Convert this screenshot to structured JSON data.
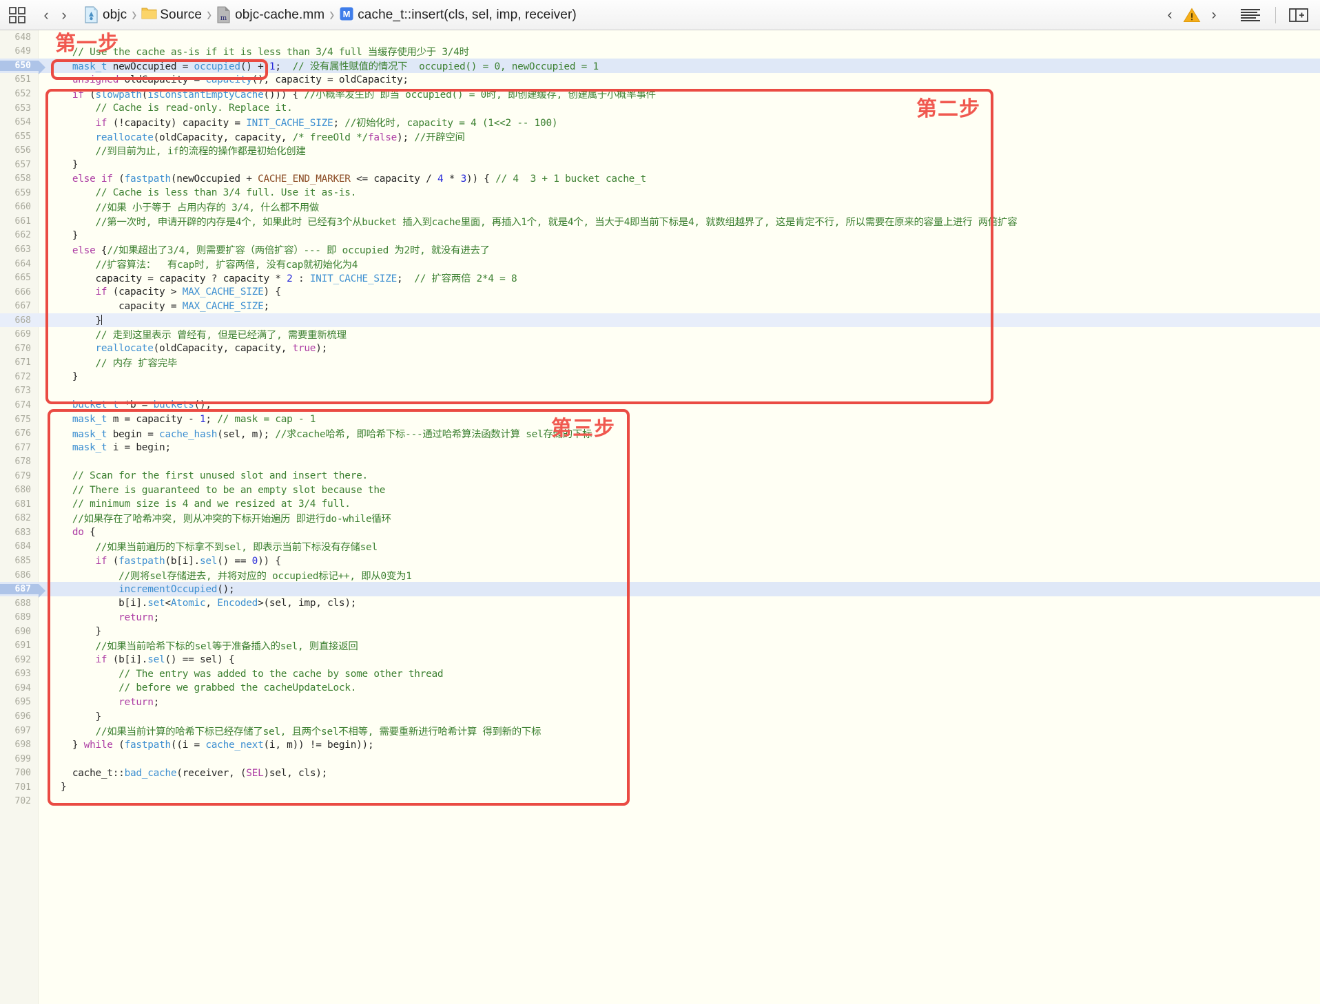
{
  "toolbar": {
    "grid_icon": "grid-icon",
    "back_label": "‹",
    "forward_label": "›",
    "breadcrumb": [
      {
        "icon": "project-icon",
        "label": "objc"
      },
      {
        "icon": "folder-icon",
        "label": "Source"
      },
      {
        "icon": "objcpp-file-icon",
        "label": "objc-cache.mm"
      },
      {
        "icon": "method-icon",
        "label": "cache_t::insert(cls, sel, imp, receiver)"
      }
    ],
    "prev_issue_label": "‹",
    "warning_icon": "warning-triangle-icon",
    "next_issue_label": "›",
    "minimap_icon": "document-lines-icon",
    "inspector_icon": "right-panel-toggle-icon"
  },
  "annotations": [
    {
      "name": "step-one-label",
      "text": "第一步"
    },
    {
      "name": "step-two-label",
      "text": "第二步"
    },
    {
      "name": "step-three-label",
      "text": "第三步"
    }
  ],
  "editor": {
    "first_line": 648,
    "highlighted_lines": [
      650,
      687
    ],
    "current_line": 668,
    "lines": [
      {
        "n": 648,
        "tokens": []
      },
      {
        "n": 649,
        "tokens": [
          {
            "t": "  ",
            "c": "plain"
          },
          {
            "t": "// Use the cache as-is if it is less than 3/4 full 当缓存使用少于 3/4时",
            "c": "cmt"
          }
        ]
      },
      {
        "n": 650,
        "tokens": [
          {
            "t": "  ",
            "c": "plain"
          },
          {
            "t": "mask_t",
            "c": "type"
          },
          {
            "t": " newOccupied = ",
            "c": "plain"
          },
          {
            "t": "occupied",
            "c": "fn"
          },
          {
            "t": "() + ",
            "c": "plain"
          },
          {
            "t": "1",
            "c": "num"
          },
          {
            "t": ";",
            "c": "plain"
          },
          {
            "t": "  // 没有属性赋值的情况下  occupied() = 0, newOccupied = 1",
            "c": "cmt"
          }
        ]
      },
      {
        "n": 651,
        "tokens": [
          {
            "t": "  ",
            "c": "plain"
          },
          {
            "t": "unsigned",
            "c": "kw"
          },
          {
            "t": " oldCapacity = ",
            "c": "plain"
          },
          {
            "t": "capacity",
            "c": "fn"
          },
          {
            "t": "(), capacity = oldCapacity;",
            "c": "plain"
          }
        ]
      },
      {
        "n": 652,
        "tokens": [
          {
            "t": "  ",
            "c": "plain"
          },
          {
            "t": "if",
            "c": "kw"
          },
          {
            "t": " (",
            "c": "plain"
          },
          {
            "t": "slowpath",
            "c": "fn"
          },
          {
            "t": "(",
            "c": "plain"
          },
          {
            "t": "isConstantEmptyCache",
            "c": "fn"
          },
          {
            "t": "())) { ",
            "c": "plain"
          },
          {
            "t": "//小概率发生的 即当 occupied() = 0时, 即创建缓存, 创建属于小概率事件",
            "c": "cmt"
          }
        ]
      },
      {
        "n": 653,
        "tokens": [
          {
            "t": "      ",
            "c": "plain"
          },
          {
            "t": "// Cache is read-only. Replace it.",
            "c": "cmt"
          }
        ]
      },
      {
        "n": 654,
        "tokens": [
          {
            "t": "      ",
            "c": "plain"
          },
          {
            "t": "if",
            "c": "kw"
          },
          {
            "t": " (!capacity) capacity = ",
            "c": "plain"
          },
          {
            "t": "INIT_CACHE_SIZE",
            "c": "type"
          },
          {
            "t": "; ",
            "c": "plain"
          },
          {
            "t": "//初始化时, capacity = 4 (1<<2 -- 100)",
            "c": "cmt"
          }
        ]
      },
      {
        "n": 655,
        "tokens": [
          {
            "t": "      ",
            "c": "plain"
          },
          {
            "t": "reallocate",
            "c": "fn"
          },
          {
            "t": "(oldCapacity, capacity, ",
            "c": "plain"
          },
          {
            "t": "/* freeOld */",
            "c": "cmt"
          },
          {
            "t": "false",
            "c": "kw"
          },
          {
            "t": "); ",
            "c": "plain"
          },
          {
            "t": "//开辟空间",
            "c": "cmt"
          }
        ]
      },
      {
        "n": 656,
        "tokens": [
          {
            "t": "      ",
            "c": "plain"
          },
          {
            "t": "//到目前为止, if的流程的操作都是初始化创建",
            "c": "cmt"
          }
        ]
      },
      {
        "n": 657,
        "tokens": [
          {
            "t": "  }",
            "c": "plain"
          }
        ]
      },
      {
        "n": 658,
        "tokens": [
          {
            "t": "  ",
            "c": "plain"
          },
          {
            "t": "else if",
            "c": "kw"
          },
          {
            "t": " (",
            "c": "plain"
          },
          {
            "t": "fastpath",
            "c": "fn"
          },
          {
            "t": "(newOccupied + ",
            "c": "plain"
          },
          {
            "t": "CACHE_END_MARKER",
            "c": "mac"
          },
          {
            "t": " <= capacity / ",
            "c": "plain"
          },
          {
            "t": "4",
            "c": "num"
          },
          {
            "t": " * ",
            "c": "plain"
          },
          {
            "t": "3",
            "c": "num"
          },
          {
            "t": ")) { ",
            "c": "plain"
          },
          {
            "t": "// 4  3 + 1 bucket cache_t",
            "c": "cmt"
          }
        ]
      },
      {
        "n": 659,
        "tokens": [
          {
            "t": "      ",
            "c": "plain"
          },
          {
            "t": "// Cache is less than 3/4 full. Use it as-is.",
            "c": "cmt"
          }
        ]
      },
      {
        "n": 660,
        "tokens": [
          {
            "t": "      ",
            "c": "plain"
          },
          {
            "t": "//如果 小于等于 占用内存的 3/4, 什么都不用做",
            "c": "cmt"
          }
        ]
      },
      {
        "n": 661,
        "tokens": [
          {
            "t": "      ",
            "c": "plain"
          },
          {
            "t": "//第一次时, 申请开辟的内存是4个, 如果此时 已经有3个从bucket 插入到cache里面, 再插入1个, 就是4个, 当大于4即当前下标是4, 就数组越界了, 这是肯定不行, 所以需要在原来的容量上进行 两倍扩容",
            "c": "cmt"
          }
        ]
      },
      {
        "n": 662,
        "tokens": [
          {
            "t": "  }",
            "c": "plain"
          }
        ]
      },
      {
        "n": 663,
        "tokens": [
          {
            "t": "  ",
            "c": "plain"
          },
          {
            "t": "else",
            "c": "kw"
          },
          {
            "t": " {",
            "c": "plain"
          },
          {
            "t": "//如果超出了3/4, 则需要扩容（两倍扩容）--- 即 occupied 为2时, 就没有进去了",
            "c": "cmt"
          }
        ]
      },
      {
        "n": 664,
        "tokens": [
          {
            "t": "      ",
            "c": "plain"
          },
          {
            "t": "//扩容算法：  有cap时, 扩容两倍, 没有cap就初始化为4",
            "c": "cmt"
          }
        ]
      },
      {
        "n": 665,
        "tokens": [
          {
            "t": "      capacity = capacity ? capacity * ",
            "c": "plain"
          },
          {
            "t": "2",
            "c": "num"
          },
          {
            "t": " : ",
            "c": "plain"
          },
          {
            "t": "INIT_CACHE_SIZE",
            "c": "type"
          },
          {
            "t": ";  ",
            "c": "plain"
          },
          {
            "t": "// 扩容两倍 2*4 = 8",
            "c": "cmt"
          }
        ]
      },
      {
        "n": 666,
        "tokens": [
          {
            "t": "      ",
            "c": "plain"
          },
          {
            "t": "if",
            "c": "kw"
          },
          {
            "t": " (capacity > ",
            "c": "plain"
          },
          {
            "t": "MAX_CACHE_SIZE",
            "c": "type"
          },
          {
            "t": ") {",
            "c": "plain"
          }
        ]
      },
      {
        "n": 667,
        "tokens": [
          {
            "t": "          capacity = ",
            "c": "plain"
          },
          {
            "t": "MAX_CACHE_SIZE",
            "c": "type"
          },
          {
            "t": ";",
            "c": "plain"
          }
        ]
      },
      {
        "n": 668,
        "tokens": [
          {
            "t": "      }",
            "c": "plain"
          }
        ],
        "caret": true
      },
      {
        "n": 669,
        "tokens": [
          {
            "t": "      ",
            "c": "plain"
          },
          {
            "t": "// 走到这里表示 曾经有, 但是已经满了, 需要重新梳理",
            "c": "cmt"
          }
        ]
      },
      {
        "n": 670,
        "tokens": [
          {
            "t": "      ",
            "c": "plain"
          },
          {
            "t": "reallocate",
            "c": "fn"
          },
          {
            "t": "(oldCapacity, capacity, ",
            "c": "plain"
          },
          {
            "t": "true",
            "c": "kw"
          },
          {
            "t": ");",
            "c": "plain"
          }
        ]
      },
      {
        "n": 671,
        "tokens": [
          {
            "t": "      ",
            "c": "plain"
          },
          {
            "t": "// 内存 扩容完毕",
            "c": "cmt"
          }
        ]
      },
      {
        "n": 672,
        "tokens": [
          {
            "t": "  }",
            "c": "plain"
          }
        ]
      },
      {
        "n": 673,
        "tokens": []
      },
      {
        "n": 674,
        "tokens": [
          {
            "t": "  ",
            "c": "plain"
          },
          {
            "t": "bucket_t",
            "c": "type"
          },
          {
            "t": " *b = ",
            "c": "plain"
          },
          {
            "t": "buckets",
            "c": "fn"
          },
          {
            "t": "();",
            "c": "plain"
          }
        ]
      },
      {
        "n": 675,
        "tokens": [
          {
            "t": "  ",
            "c": "plain"
          },
          {
            "t": "mask_t",
            "c": "type"
          },
          {
            "t": " m = capacity - ",
            "c": "plain"
          },
          {
            "t": "1",
            "c": "num"
          },
          {
            "t": "; ",
            "c": "plain"
          },
          {
            "t": "// mask = cap - 1",
            "c": "cmt"
          }
        ]
      },
      {
        "n": 676,
        "tokens": [
          {
            "t": "  ",
            "c": "plain"
          },
          {
            "t": "mask_t",
            "c": "type"
          },
          {
            "t": " begin = ",
            "c": "plain"
          },
          {
            "t": "cache_hash",
            "c": "fn"
          },
          {
            "t": "(sel, m); ",
            "c": "plain"
          },
          {
            "t": "//求cache哈希, 即哈希下标---通过哈希算法函数计算 sel存储的下标",
            "c": "cmt"
          }
        ]
      },
      {
        "n": 677,
        "tokens": [
          {
            "t": "  ",
            "c": "plain"
          },
          {
            "t": "mask_t",
            "c": "type"
          },
          {
            "t": " i = begin;",
            "c": "plain"
          }
        ]
      },
      {
        "n": 678,
        "tokens": []
      },
      {
        "n": 679,
        "tokens": [
          {
            "t": "  ",
            "c": "plain"
          },
          {
            "t": "// Scan for the first unused slot and insert there.",
            "c": "cmt"
          }
        ]
      },
      {
        "n": 680,
        "tokens": [
          {
            "t": "  ",
            "c": "plain"
          },
          {
            "t": "// There is guaranteed to be an empty slot because the",
            "c": "cmt"
          }
        ]
      },
      {
        "n": 681,
        "tokens": [
          {
            "t": "  ",
            "c": "plain"
          },
          {
            "t": "// minimum size is 4 and we resized at 3/4 full.",
            "c": "cmt"
          }
        ]
      },
      {
        "n": 682,
        "tokens": [
          {
            "t": "  ",
            "c": "plain"
          },
          {
            "t": "//如果存在了哈希冲突, 则从冲突的下标开始遍历 即进行do-while循环",
            "c": "cmt"
          }
        ]
      },
      {
        "n": 683,
        "tokens": [
          {
            "t": "  ",
            "c": "plain"
          },
          {
            "t": "do",
            "c": "kw"
          },
          {
            "t": " {",
            "c": "plain"
          }
        ]
      },
      {
        "n": 684,
        "tokens": [
          {
            "t": "      ",
            "c": "plain"
          },
          {
            "t": "//如果当前遍历的下标拿不到sel, 即表示当前下标没有存储sel",
            "c": "cmt"
          }
        ]
      },
      {
        "n": 685,
        "tokens": [
          {
            "t": "      ",
            "c": "plain"
          },
          {
            "t": "if",
            "c": "kw"
          },
          {
            "t": " (",
            "c": "plain"
          },
          {
            "t": "fastpath",
            "c": "fn"
          },
          {
            "t": "(b[i].",
            "c": "plain"
          },
          {
            "t": "sel",
            "c": "fn"
          },
          {
            "t": "() == ",
            "c": "plain"
          },
          {
            "t": "0",
            "c": "num"
          },
          {
            "t": ")) {",
            "c": "plain"
          }
        ]
      },
      {
        "n": 686,
        "tokens": [
          {
            "t": "          ",
            "c": "plain"
          },
          {
            "t": "//则将sel存储进去, 并将对应的 occupied标记++, 即从0变为1",
            "c": "cmt"
          }
        ]
      },
      {
        "n": 687,
        "tokens": [
          {
            "t": "          ",
            "c": "plain"
          },
          {
            "t": "incrementOccupied",
            "c": "fn"
          },
          {
            "t": "();",
            "c": "plain"
          }
        ]
      },
      {
        "n": 688,
        "tokens": [
          {
            "t": "          b[i].",
            "c": "plain"
          },
          {
            "t": "set",
            "c": "fn"
          },
          {
            "t": "<",
            "c": "plain"
          },
          {
            "t": "Atomic",
            "c": "type"
          },
          {
            "t": ", ",
            "c": "plain"
          },
          {
            "t": "Encoded",
            "c": "type"
          },
          {
            "t": ">(sel, imp, cls);",
            "c": "plain"
          }
        ]
      },
      {
        "n": 689,
        "tokens": [
          {
            "t": "          ",
            "c": "plain"
          },
          {
            "t": "return",
            "c": "kw"
          },
          {
            "t": ";",
            "c": "plain"
          }
        ]
      },
      {
        "n": 690,
        "tokens": [
          {
            "t": "      }",
            "c": "plain"
          }
        ]
      },
      {
        "n": 691,
        "tokens": [
          {
            "t": "      ",
            "c": "plain"
          },
          {
            "t": "//如果当前哈希下标的sel等于准备插入的sel, 则直接返回",
            "c": "cmt"
          }
        ]
      },
      {
        "n": 692,
        "tokens": [
          {
            "t": "      ",
            "c": "plain"
          },
          {
            "t": "if",
            "c": "kw"
          },
          {
            "t": " (b[i].",
            "c": "plain"
          },
          {
            "t": "sel",
            "c": "fn"
          },
          {
            "t": "() == sel) {",
            "c": "plain"
          }
        ]
      },
      {
        "n": 693,
        "tokens": [
          {
            "t": "          ",
            "c": "plain"
          },
          {
            "t": "// The entry was added to the cache by some other thread",
            "c": "cmt"
          }
        ]
      },
      {
        "n": 694,
        "tokens": [
          {
            "t": "          ",
            "c": "plain"
          },
          {
            "t": "// before we grabbed the cacheUpdateLock.",
            "c": "cmt"
          }
        ]
      },
      {
        "n": 695,
        "tokens": [
          {
            "t": "          ",
            "c": "plain"
          },
          {
            "t": "return",
            "c": "kw"
          },
          {
            "t": ";",
            "c": "plain"
          }
        ]
      },
      {
        "n": 696,
        "tokens": [
          {
            "t": "      }",
            "c": "plain"
          }
        ]
      },
      {
        "n": 697,
        "tokens": [
          {
            "t": "      ",
            "c": "plain"
          },
          {
            "t": "//如果当前计算的哈希下标已经存储了sel, 且两个sel不相等, 需要重新进行哈希计算 得到新的下标",
            "c": "cmt"
          }
        ]
      },
      {
        "n": 698,
        "tokens": [
          {
            "t": "  } ",
            "c": "plain"
          },
          {
            "t": "while",
            "c": "kw"
          },
          {
            "t": " (",
            "c": "plain"
          },
          {
            "t": "fastpath",
            "c": "fn"
          },
          {
            "t": "((i = ",
            "c": "plain"
          },
          {
            "t": "cache_next",
            "c": "fn"
          },
          {
            "t": "(i, m)) != begin));",
            "c": "plain"
          }
        ]
      },
      {
        "n": 699,
        "tokens": []
      },
      {
        "n": 700,
        "tokens": [
          {
            "t": "  ",
            "c": "plain"
          },
          {
            "t": "cache_t",
            "c": "plain"
          },
          {
            "t": "::",
            "c": "plain"
          },
          {
            "t": "bad_cache",
            "c": "fn"
          },
          {
            "t": "(receiver, (",
            "c": "plain"
          },
          {
            "t": "SEL",
            "c": "kw"
          },
          {
            "t": ")sel, cls);",
            "c": "plain"
          }
        ]
      },
      {
        "n": 701,
        "tokens": [
          {
            "t": "}",
            "c": "plain"
          }
        ]
      },
      {
        "n": 702,
        "tokens": []
      }
    ]
  },
  "colors": {
    "background": "#fffff4",
    "gutter": "#f7f7ee",
    "annotation_red": "#ea4b43",
    "keyword": "#ad3da4",
    "comment": "#3c8031",
    "type": "#3d8fd1",
    "number": "#272ad8",
    "macro": "#8a4a22",
    "current_line": "#e8eefa",
    "highlight_line": "#aec4e8",
    "warning": "#f5ae1a"
  }
}
